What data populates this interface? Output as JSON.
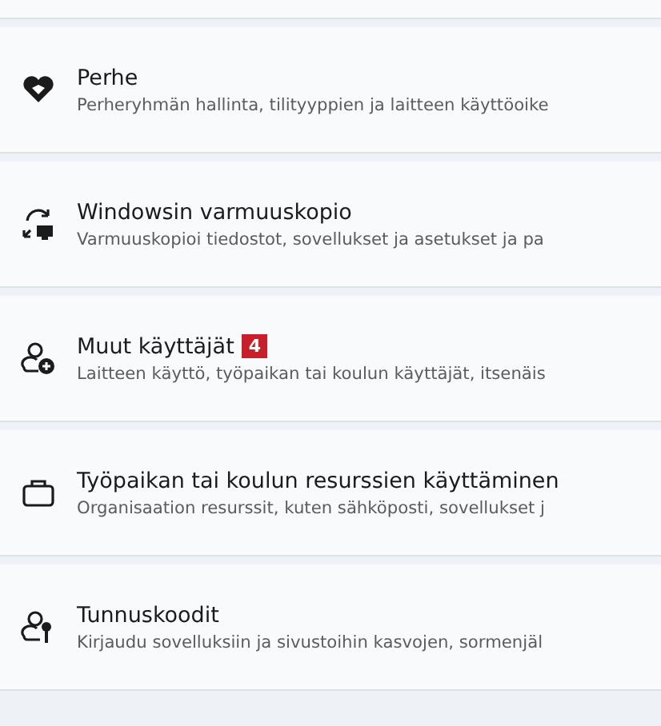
{
  "items": [
    {
      "title": "Perhe",
      "subtitle": "Perheryhmän hallinta, tilityyppien ja laitteen käyttöoike"
    },
    {
      "title": "Windowsin varmuuskopio",
      "subtitle": "Varmuuskopioi tiedostot, sovellukset ja asetukset ja pa"
    },
    {
      "title": "Muut käyttäjät",
      "badge": "4",
      "subtitle": "Laitteen käyttö, työpaikan tai koulun käyttäjät, itsenäis"
    },
    {
      "title": "Työpaikan tai koulun resurssien käyttäminen",
      "subtitle": "Organisaation resurssit, kuten sähköposti, sovellukset j"
    },
    {
      "title": "Tunnuskoodit",
      "subtitle": "Kirjaudu sovelluksiin ja sivustoihin kasvojen, sormenjäl"
    }
  ]
}
